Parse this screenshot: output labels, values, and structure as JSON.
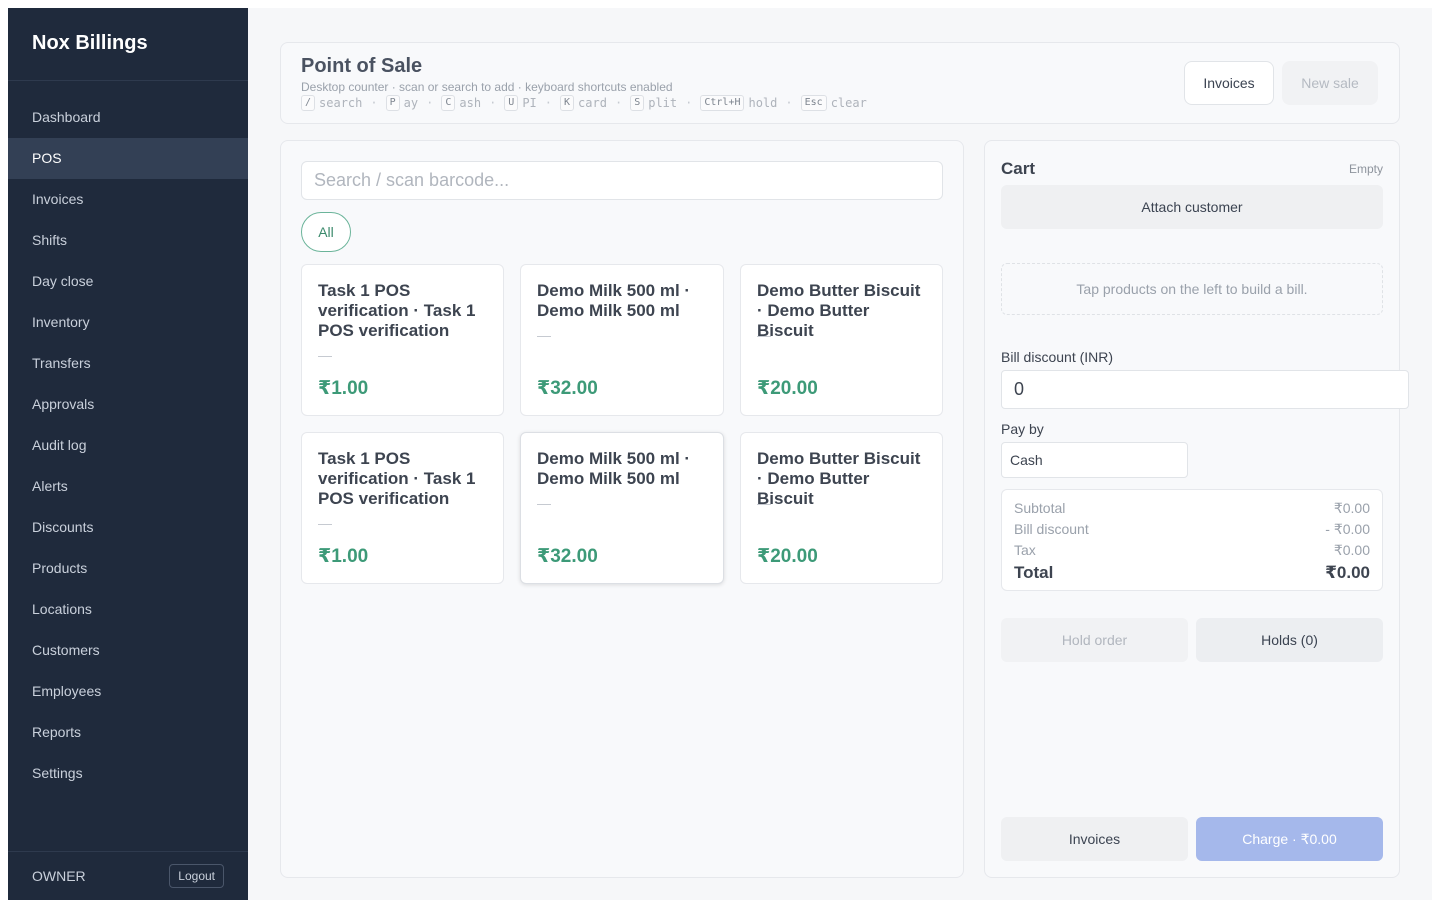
{
  "app": {
    "brand": "Nox Billings"
  },
  "sidebar": {
    "items": [
      {
        "label": "Dashboard",
        "active": false
      },
      {
        "label": "POS",
        "active": true
      },
      {
        "label": "Invoices",
        "active": false
      },
      {
        "label": "Shifts",
        "active": false
      },
      {
        "label": "Day close",
        "active": false
      },
      {
        "label": "Inventory",
        "active": false
      },
      {
        "label": "Transfers",
        "active": false
      },
      {
        "label": "Approvals",
        "active": false
      },
      {
        "label": "Audit log",
        "active": false
      },
      {
        "label": "Alerts",
        "active": false
      },
      {
        "label": "Discounts",
        "active": false
      },
      {
        "label": "Products",
        "active": false
      },
      {
        "label": "Locations",
        "active": false
      },
      {
        "label": "Customers",
        "active": false
      },
      {
        "label": "Employees",
        "active": false
      },
      {
        "label": "Reports",
        "active": false
      },
      {
        "label": "Settings",
        "active": false
      }
    ],
    "role": "OWNER",
    "logout_label": "Logout"
  },
  "header": {
    "title": "Point of Sale",
    "subtitle": "Desktop counter · scan or search to add · keyboard shortcuts enabled",
    "shortcuts": [
      {
        "key": "/",
        "word": "search"
      },
      {
        "key": "P",
        "word": "ay"
      },
      {
        "key": "C",
        "word": "ash"
      },
      {
        "key": "U",
        "word": "PI"
      },
      {
        "key": "K",
        "word": "card"
      },
      {
        "key": "S",
        "word": "plit"
      },
      {
        "key": "Ctrl+H",
        "word": "hold"
      },
      {
        "key": "Esc",
        "word": "clear"
      }
    ],
    "separator": "·",
    "invoices_label": "Invoices",
    "new_sale_label": "New sale"
  },
  "products": {
    "search_placeholder": "Search / scan barcode...",
    "category_chip": "All",
    "items": [
      {
        "name": "Task 1 POS verification · Task 1 POS verification",
        "dash": "—",
        "price": "₹1.00"
      },
      {
        "name": "Demo Milk 500 ml · Demo Milk 500 ml",
        "dash": "—",
        "price": "₹32.00"
      },
      {
        "name": "Demo Butter Biscuit · Demo Butter Biscuit",
        "dash": "—",
        "price": "₹20.00"
      },
      {
        "name": "Task 1 POS verification · Task 1 POS verification",
        "dash": "—",
        "price": "₹1.00"
      },
      {
        "name": "Demo Milk 500 ml · Demo Milk 500 ml",
        "dash": "—",
        "price": "₹32.00"
      },
      {
        "name": "Demo Butter Biscuit · Demo Butter Biscuit",
        "dash": "—",
        "price": "₹20.00"
      }
    ]
  },
  "cart": {
    "title": "Cart",
    "status": "Empty",
    "attach_customer_label": "Attach customer",
    "empty_hint": "Tap products on the left to build a bill.",
    "bill_discount_label": "Bill discount (INR)",
    "bill_discount_value": "0",
    "pay_by_label": "Pay by",
    "pay_by_value": "Cash",
    "totals": {
      "subtotal_label": "Subtotal",
      "subtotal_value": "₹0.00",
      "discount_label": "Bill discount",
      "discount_value": "- ₹0.00",
      "tax_label": "Tax",
      "tax_value": "₹0.00",
      "total_label": "Total",
      "total_value": "₹0.00"
    },
    "hold_order_label": "Hold order",
    "holds_label": "Holds (0)",
    "invoices_label": "Invoices",
    "charge_label": "Charge · ₹0.00"
  }
}
